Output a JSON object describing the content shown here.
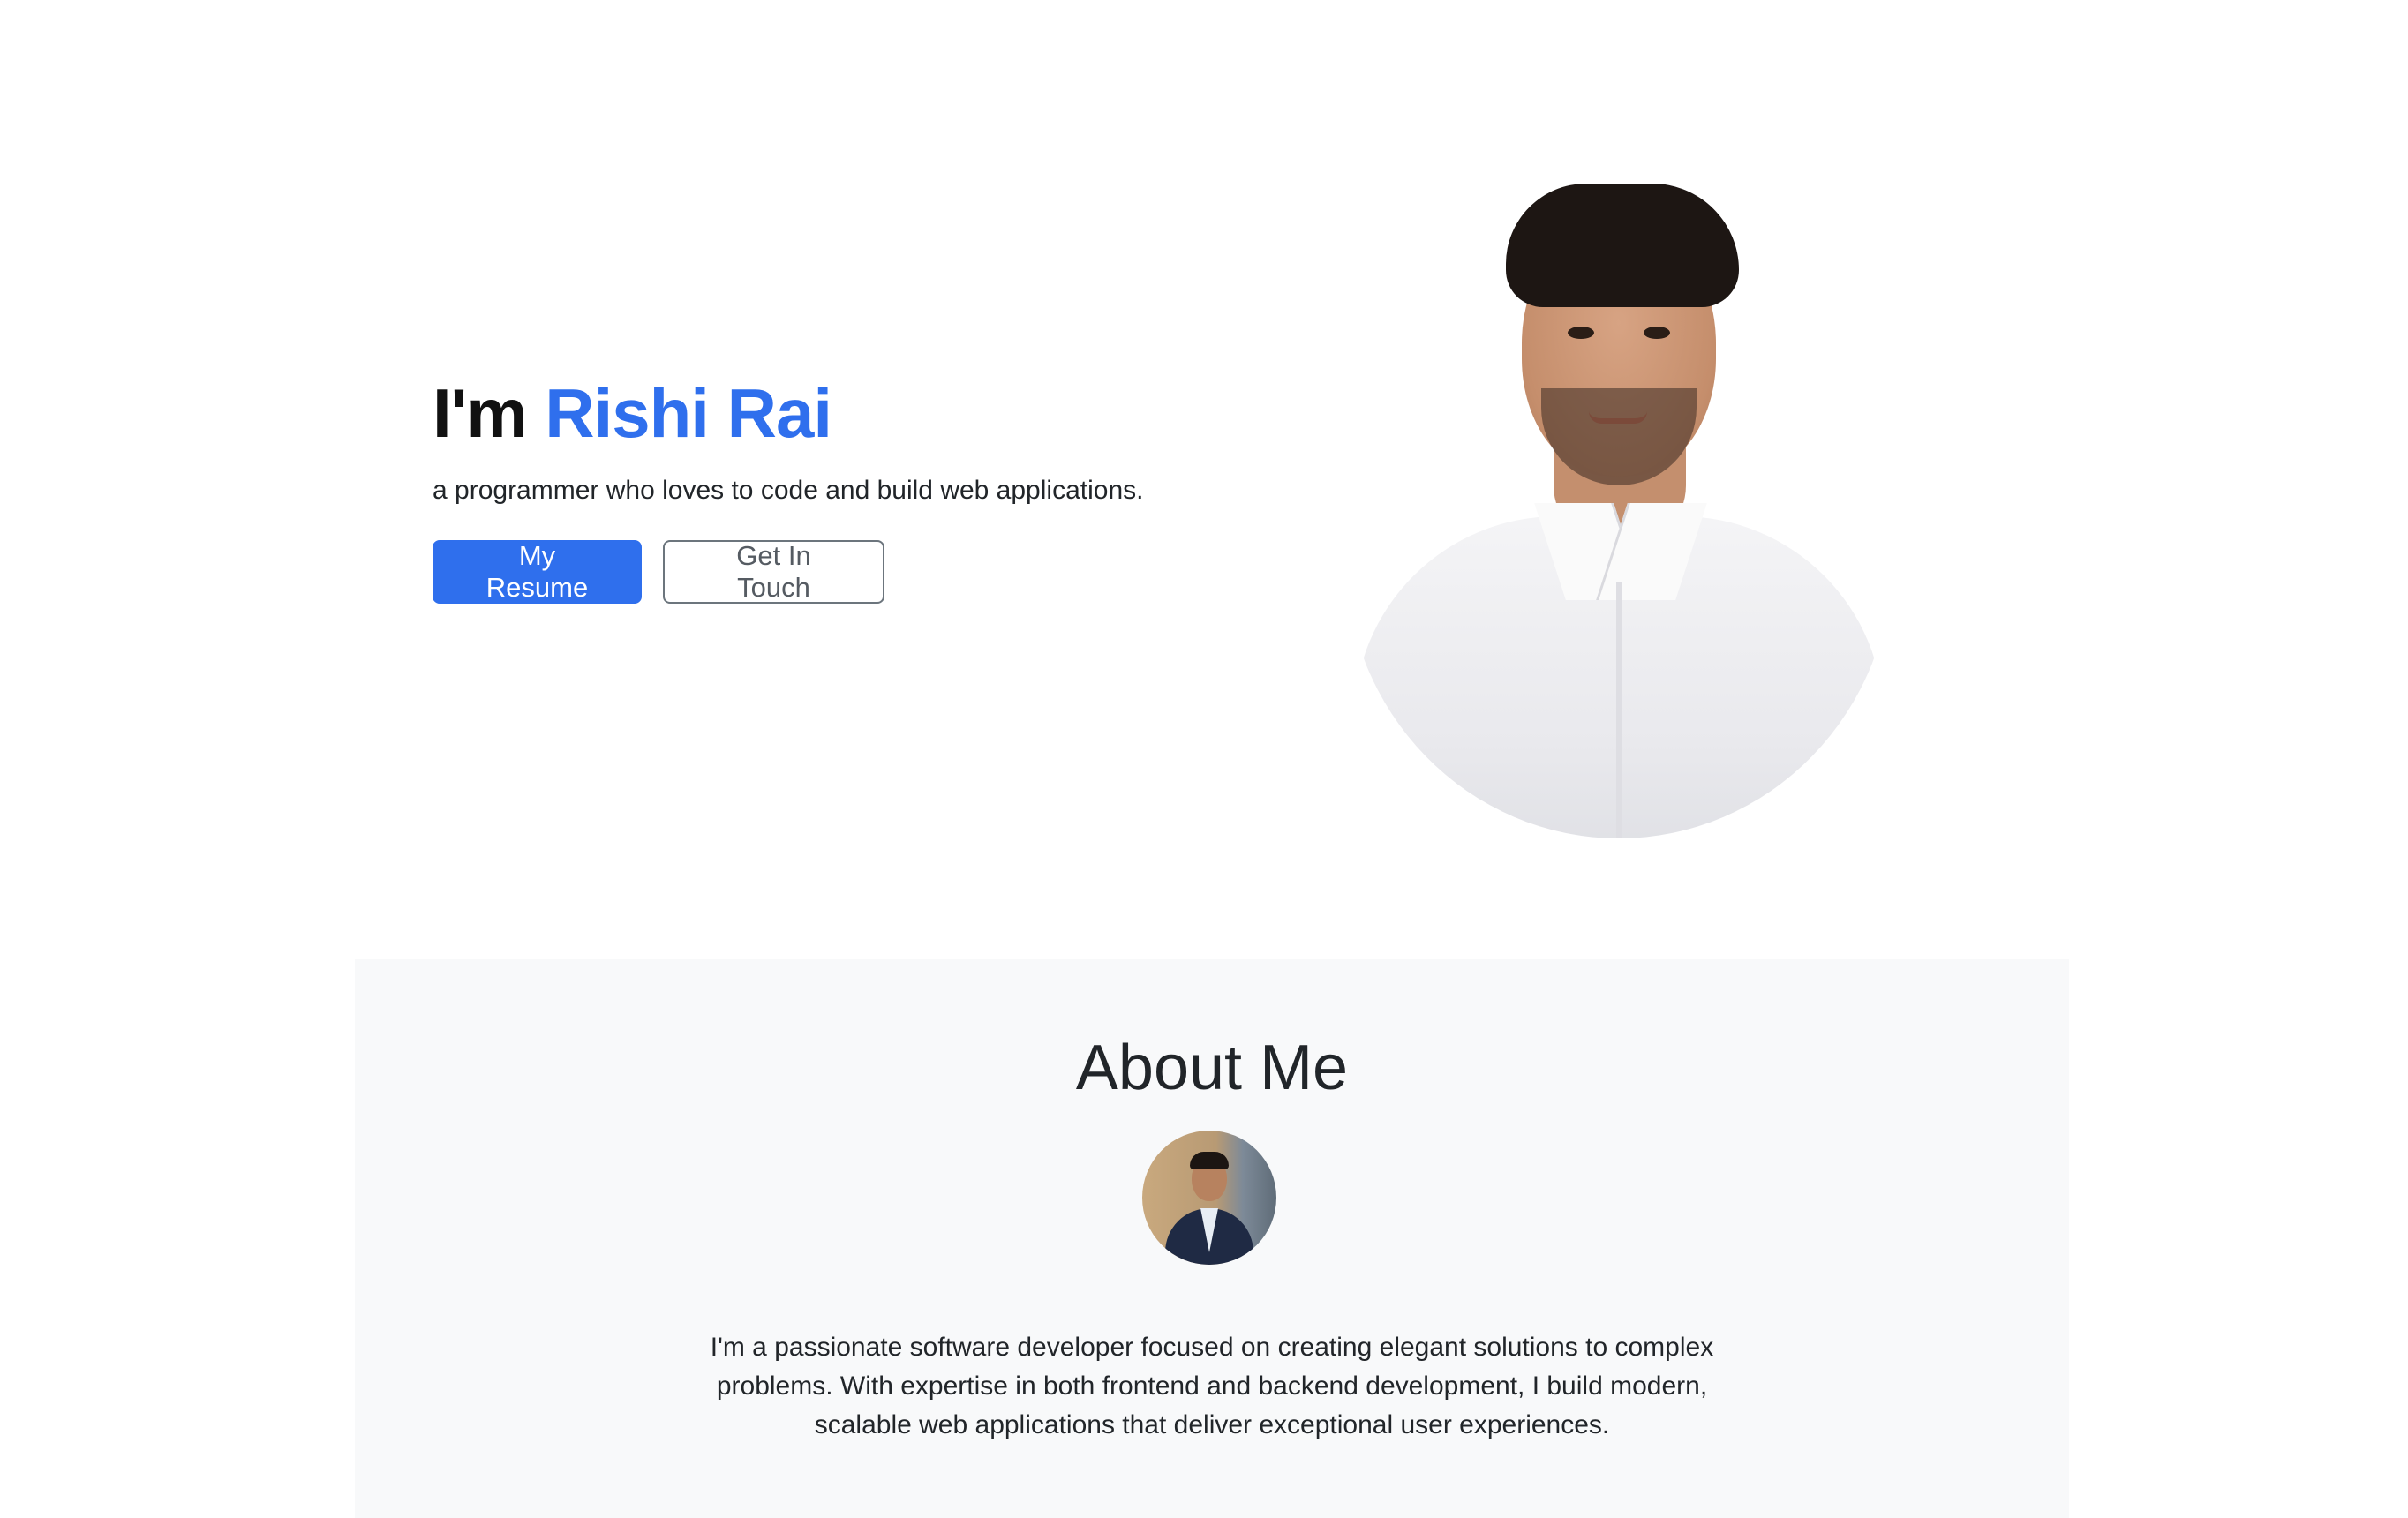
{
  "hero": {
    "greeting": "I'm",
    "name": "Rishi Rai",
    "subtitle": "a programmer who loves to code and build web applications.",
    "buttons": {
      "resume": "My Resume",
      "contact": "Get In Touch"
    }
  },
  "about": {
    "title": "About Me",
    "description": "I'm a passionate software developer focused on creating elegant solutions to complex problems. With expertise in both frontend and backend development, I build modern, scalable web applications that deliver exceptional user experiences."
  },
  "colors": {
    "accent": "#2f6fed",
    "about_background": "#f8f9fa",
    "outline_border": "#6c757d"
  }
}
